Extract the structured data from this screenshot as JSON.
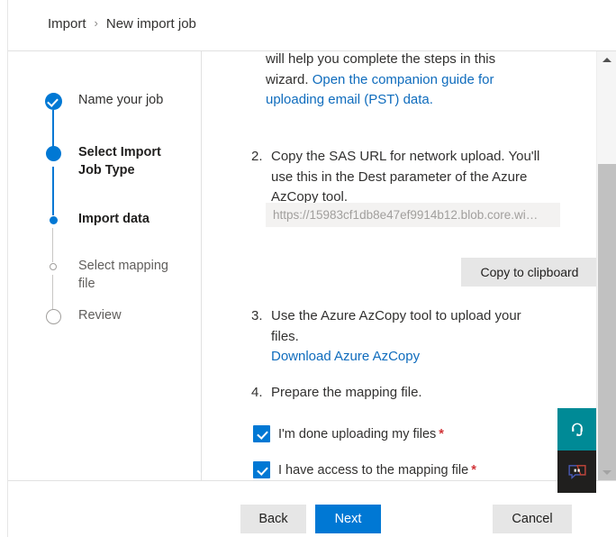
{
  "header": {
    "breadcrumb": {
      "root_label": "Import",
      "separator": "›",
      "current_label": "New import job"
    }
  },
  "sidebar": {
    "steps": [
      {
        "label": "Name your job",
        "state": "completed",
        "marker": "check-circle-icon"
      },
      {
        "label": "Select Import Job Type",
        "state": "current",
        "marker": "filled-circle-icon"
      },
      {
        "label": "Import data",
        "state": "next",
        "marker": "small-dot-icon"
      },
      {
        "label": "Select mapping file",
        "state": "pending",
        "marker": "small-ring-icon"
      },
      {
        "label": "Review",
        "state": "pending",
        "marker": "large-ring-icon"
      }
    ]
  },
  "content": {
    "intro_text_line1": "will help you complete the steps in this",
    "intro_text_line2": "wizard.",
    "intro_link": "Open the companion guide for uploading email (PST) data.",
    "step2": {
      "index": "2.",
      "text": "Copy the SAS URL for network upload. You'll use this in the Dest parameter of the Azure AzCopy tool.",
      "sas_url_value": "https://15983cf1db8e47ef9914b12.blob.core.wi…",
      "copy_button": "Copy to clipboard"
    },
    "step3": {
      "index": "3.",
      "text": "Use the Azure AzCopy tool to upload your files.",
      "link": "Download Azure AzCopy"
    },
    "step4": {
      "index": "4.",
      "text": "Prepare the mapping file."
    },
    "checkboxes": [
      {
        "label": "I'm done uploading my files",
        "required_marker": "*",
        "checked": true
      },
      {
        "label": "I have access to the mapping file",
        "required_marker": "*",
        "checked": true
      }
    ]
  },
  "scrollbar": {
    "up_arrow": "scroll-up-icon",
    "down_arrow": "scroll-down-icon"
  },
  "footer": {
    "back_label": "Back",
    "next_label": "Next",
    "cancel_label": "Cancel"
  },
  "side_widgets": [
    {
      "name": "support-headset-icon",
      "background": "#008a96"
    },
    {
      "name": "feedback-chat-icon",
      "background": "#201f1e"
    }
  ],
  "colors": {
    "accent": "#0078d4",
    "link": "#0f6cbd",
    "required": "#d13438",
    "support_teal": "#008a96",
    "feedback_dark": "#201f1e"
  }
}
